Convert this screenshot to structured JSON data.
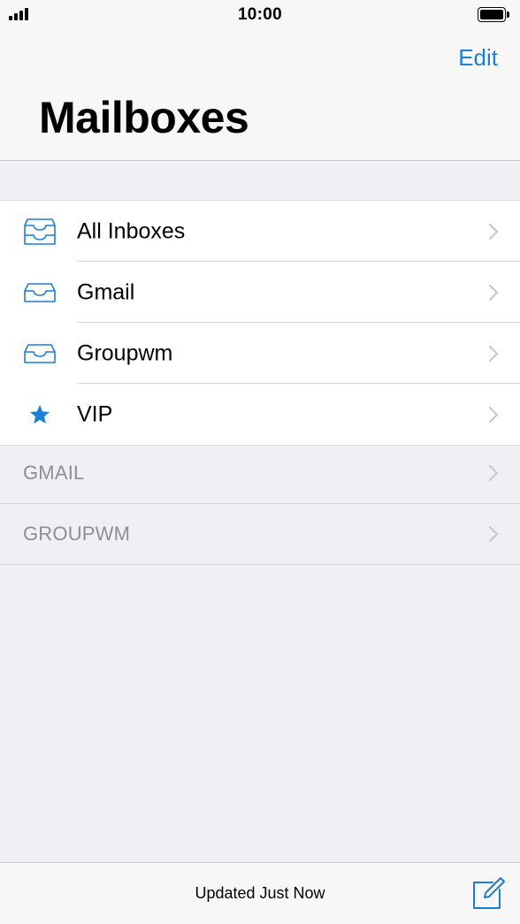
{
  "status_bar": {
    "time": "10:00"
  },
  "nav": {
    "edit_label": "Edit",
    "title": "Mailboxes"
  },
  "mailboxes": [
    {
      "label": "All Inboxes",
      "icon": "all-inboxes-icon"
    },
    {
      "label": "Gmail",
      "icon": "inbox-tray-icon"
    },
    {
      "label": "Groupwm",
      "icon": "inbox-tray-icon"
    },
    {
      "label": "VIP",
      "icon": "star-icon"
    }
  ],
  "accounts": [
    {
      "label": "GMAIL"
    },
    {
      "label": "GROUPWM"
    }
  ],
  "toolbar": {
    "status_text": "Updated Just Now"
  },
  "colors": {
    "accent": "#1c7fd6",
    "secondary_text": "#8e8e93",
    "background": "#efeff4"
  }
}
